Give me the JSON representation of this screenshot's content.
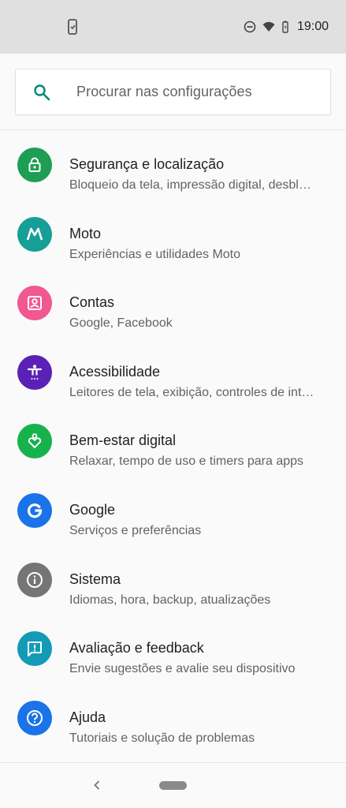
{
  "status_bar": {
    "time": "19:00",
    "icons": [
      "phone-notification-icon",
      "do-not-disturb-icon",
      "wifi-icon",
      "battery-icon"
    ]
  },
  "search": {
    "placeholder": "Procurar nas configurações",
    "icon": "search-icon",
    "accent": "#00897b"
  },
  "settings": [
    {
      "key": "security",
      "title": "Segurança e localização",
      "subtitle": "Bloqueio da tela, impressão digital, desbl…",
      "icon": "lock-icon",
      "color": "#1e9e54"
    },
    {
      "key": "moto",
      "title": "Moto",
      "subtitle": "Experiências e utilidades Moto",
      "icon": "moto-icon",
      "color": "#159f97"
    },
    {
      "key": "accounts",
      "title": "Contas",
      "subtitle": "Google, Facebook",
      "icon": "account-box-icon",
      "color": "#f0588f"
    },
    {
      "key": "accessibility",
      "title": "Acessibilidade",
      "subtitle": "Leitores de tela, exibição, controles de int…",
      "icon": "accessibility-icon",
      "color": "#5b21b6"
    },
    {
      "key": "wellbeing",
      "title": "Bem-estar digital",
      "subtitle": "Relaxar, tempo de uso e timers para apps",
      "icon": "wellbeing-heart-icon",
      "color": "#16b34c"
    },
    {
      "key": "google",
      "title": "Google",
      "subtitle": "Serviços e preferências",
      "icon": "google-g-icon",
      "color": "#1a73e8"
    },
    {
      "key": "system",
      "title": "Sistema",
      "subtitle": "Idiomas, hora, backup, atualizações",
      "icon": "info-icon",
      "color": "#757575"
    },
    {
      "key": "feedback",
      "title": "Avaliação e feedback",
      "subtitle": "Envie sugestões e avalie seu dispositivo",
      "icon": "feedback-icon",
      "color": "#139bb6"
    },
    {
      "key": "help",
      "title": "Ajuda",
      "subtitle": "Tutoriais e solução de problemas",
      "icon": "help-icon",
      "color": "#1a73e8"
    }
  ],
  "nav_bar": {
    "back_icon": "back-chevron-icon",
    "home_icon": "home-pill-icon"
  }
}
